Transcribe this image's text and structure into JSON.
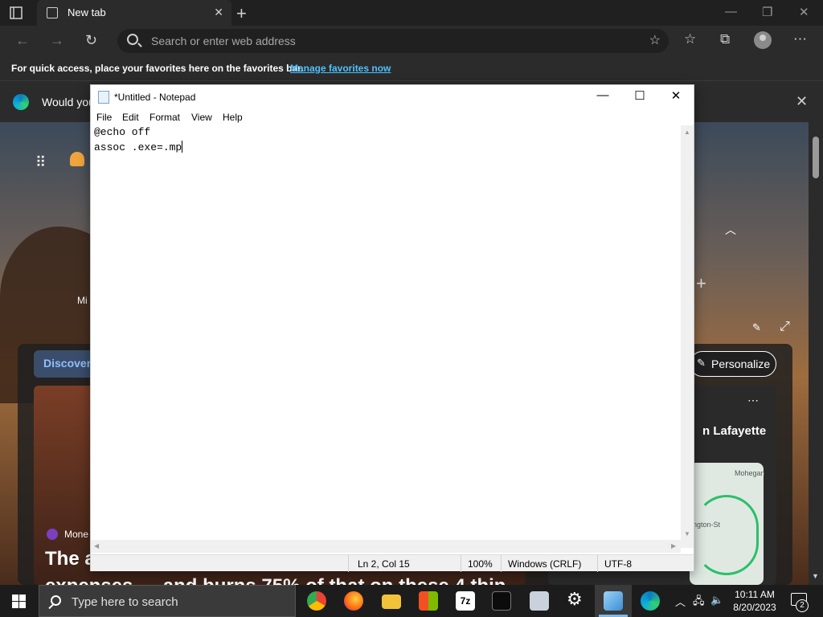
{
  "browser": {
    "tab_title": "New tab",
    "address_placeholder": "Search or enter web address",
    "favbar_text": "For quick access, place your favorites here on the favorites bar.",
    "favbar_link": "Manage favorites now",
    "infobar_text": "Would you",
    "icons": [
      "tab-actions-icon",
      "close-icon",
      "plus-icon",
      "back-icon",
      "forward-icon",
      "refresh-icon",
      "search-icon",
      "add-favorite-icon",
      "favorites-icon",
      "collections-icon",
      "profile-icon",
      "more-icon"
    ]
  },
  "ntp": {
    "side_label": "Mi",
    "discover_label": "Discover",
    "personalize_label": "Personalize",
    "story_source": "Mone",
    "story_headline": "The a",
    "story_headline2": "expenses — and burns 75% of that on these 4 thin",
    "weather_city": "n Lafayette",
    "map_label_1": "Mohegan",
    "map_label_2": "ington-St"
  },
  "notepad": {
    "title": "*Untitled - Notepad",
    "menu": [
      "File",
      "Edit",
      "Format",
      "View",
      "Help"
    ],
    "lines": [
      "@echo off",
      "assoc .exe=.mp"
    ],
    "status": {
      "position": "Ln 2, Col 15",
      "zoom": "100%",
      "line_endings": "Windows (CRLF)",
      "encoding": "UTF-8"
    }
  },
  "taskbar": {
    "search_placeholder": "Type here to search",
    "time": "10:11 AM",
    "date": "8/20/2023",
    "notification_count": "2",
    "apps": [
      "chrome",
      "firefox",
      "file-explorer",
      "microsoft-store",
      "7-zip",
      "terminal",
      "network-drive",
      "settings",
      "notepad",
      "edge"
    ]
  },
  "colors": {
    "link": "#4cc2ff",
    "discover": "#8ec0ff",
    "taskbar": "#1c1c1c",
    "chrome_bg": "#202020"
  }
}
